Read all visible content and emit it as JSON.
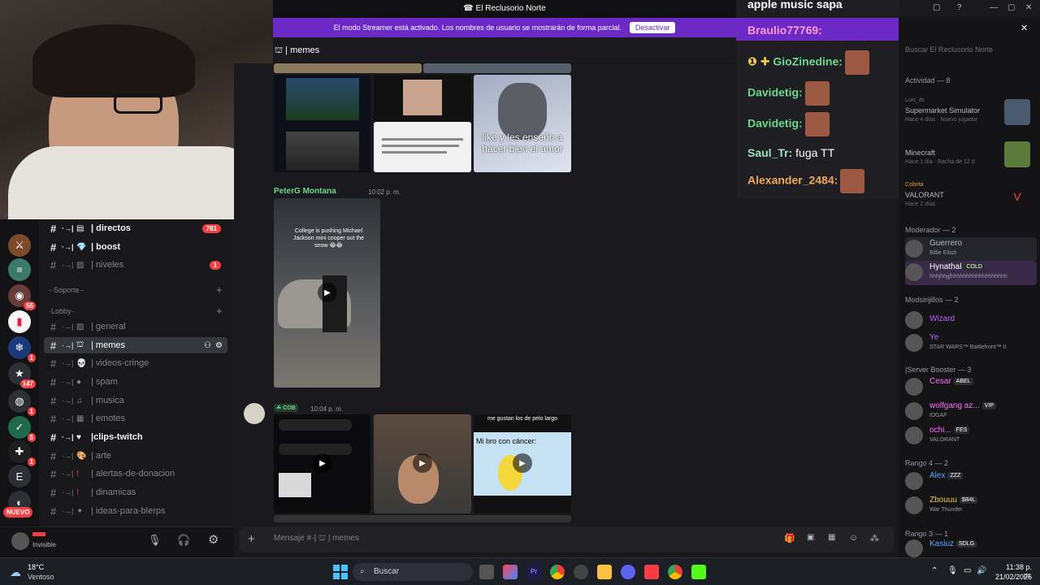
{
  "window": {
    "title": "El Reclusorio Norte"
  },
  "streamer_banner": {
    "text": "El modo Streamer está activado. Los nombres de usuario se mostrarán de forma parcial.",
    "button": "Desactivar"
  },
  "channel_header": {
    "name": "| memes"
  },
  "rail": {
    "badges": [
      "55",
      "1",
      "147",
      "1",
      "5",
      "1"
    ],
    "letter": "E",
    "nuevo": "NUEVO"
  },
  "channels": [
    {
      "label": "| directos",
      "count": "781",
      "bold": true
    },
    {
      "label": "| boost",
      "bold": true
    },
    {
      "label": "| niveles",
      "count": "1"
    },
    {
      "label": "| general"
    },
    {
      "label": "| memes",
      "active": true
    },
    {
      "label": "| videos-cringe"
    },
    {
      "label": "| spam"
    },
    {
      "label": "| musica"
    },
    {
      "label": "| emotes"
    },
    {
      "label": "|clips-twitch",
      "bold": true
    },
    {
      "label": "| arte"
    },
    {
      "label": "| alertas-de-donacion"
    },
    {
      "label": "| dinamicas"
    },
    {
      "label": "| ideas-para-blerps"
    }
  ],
  "categories": {
    "soporte": "-·Soporte·-",
    "lobby": "·Lobby·"
  },
  "user": {
    "status": "Invisible"
  },
  "messages": [
    {
      "author": "PeterG Montana",
      "time": "10:02 p. m.",
      "video_caption": "College is pushing Michael Jackson mini cooper out the snow 😂😂"
    },
    {
      "author": "COB",
      "time": "10:04 p. m."
    }
  ],
  "image_texts": {
    "meme1": "like y les enseño a hacer bien el amor",
    "meme2": "Mi bro con cáncer:",
    "meme3": "me gustan los de pelo largo"
  },
  "input": {
    "placeholder": "Mensaje #·|memes",
    "channel": "| memes"
  },
  "chat_overlay": {
    "top": "apple music sapa",
    "lines": [
      {
        "user": "Braulio77769:",
        "msg": ""
      },
      {
        "user": "GioZinedine:",
        "msg": ""
      },
      {
        "user": "Davidetig:",
        "msg": ""
      },
      {
        "user": "Davidetig:",
        "msg": ""
      },
      {
        "user": "Saul_Tr:",
        "msg": "fuga TT"
      },
      {
        "user": "Alexander_2484:",
        "msg": ""
      }
    ]
  },
  "right_panel": {
    "search": "Buscar El Reclusorio Norte",
    "activity_header": "Actividad — 8",
    "activities": [
      {
        "user": "Luis_dc",
        "game": "Supermarket Simulator",
        "meta": "Hace 4 días",
        "extra": "Nuevo jugador"
      },
      {
        "user": "",
        "game": "Minecraft",
        "meta": "Hace 1 día",
        "extra": "Racha de 12 d"
      },
      {
        "user": "Cobrita",
        "game": "VALORANT",
        "meta": "Hace 2 días",
        "extra": ""
      }
    ],
    "groups": [
      {
        "title": "Moderador — 2",
        "members": [
          {
            "name": "Guerrero",
            "status": "Billie Eilish",
            "color": "#b5bac1"
          },
          {
            "name": "Hynathal",
            "tag": "COLD",
            "status": "hhhjhhjjjhhhhhhhhhhhhhhhhhh",
            "color": "#ffffff"
          }
        ]
      },
      {
        "title": "Modsirijillos — 2",
        "members": [
          {
            "name": "Wizard",
            "status": "",
            "color": "#c061ff"
          },
          {
            "name": "Ye",
            "status": "STAR WARS™ Battlefront™ II",
            "color": "#c061ff"
          }
        ]
      },
      {
        "title": "|Server Booster — 3",
        "members": [
          {
            "name": "Cesar",
            "tag": "ABEL",
            "status": "",
            "color": "#ff73fa"
          },
          {
            "name": "wolfgang az...",
            "tag": "VIP",
            "status": "IDGAF",
            "color": "#ff73fa"
          },
          {
            "name": "ochi...",
            "tag": "FES",
            "status": "VALORANT",
            "color": "#ff73fa"
          }
        ]
      },
      {
        "title": "Rango 4 — 2",
        "members": [
          {
            "name": "Alex",
            "tag": "ZZZ",
            "status": "",
            "color": "#5fa8ff"
          },
          {
            "name": "Zbouuu",
            "tag": "$B4L",
            "status": "War Thunder",
            "color": "#f0c94a"
          }
        ]
      },
      {
        "title": "Rango 3 — 1",
        "members": [
          {
            "name": "Kasiuz",
            "tag": "SDLG",
            "status": "",
            "color": "#5fa8ff"
          }
        ]
      }
    ]
  },
  "taskbar": {
    "weather_temp": "18°C",
    "weather_desc": "Ventoso",
    "search": "Buscar",
    "time": "11:38 p. m.",
    "date": "21/02/2026"
  }
}
